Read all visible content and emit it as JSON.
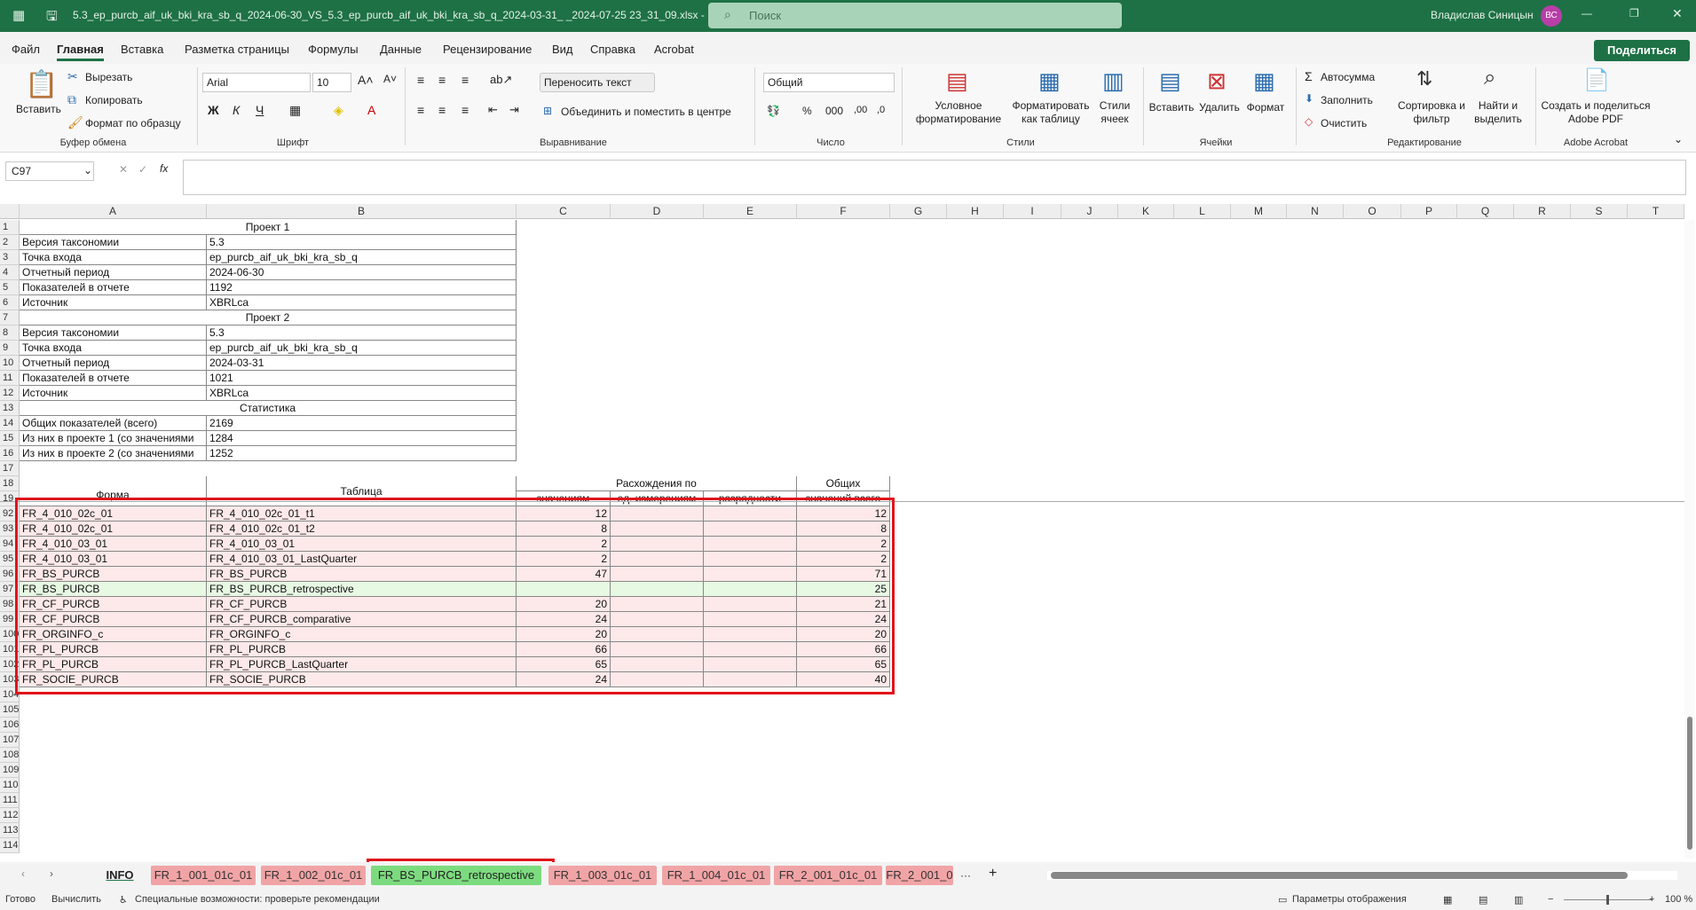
{
  "title_bar": {
    "file_name": "5.3_ep_purcb_aif_uk_bki_kra_sb_q_2024-06-30_VS_5.3_ep_purcb_aif_uk_bki_kra_sb_q_2024-03-31_ _2024-07-25 23_31_09.xlsx  -  Excel",
    "search_placeholder": "Поиск",
    "user_name": "Владислав Синицын",
    "user_initials": "ВС"
  },
  "menu": {
    "items": [
      "Файл",
      "Главная",
      "Вставка",
      "Разметка страницы",
      "Формулы",
      "Данные",
      "Рецензирование",
      "Вид",
      "Справка",
      "Acrobat"
    ],
    "active": "Главная",
    "share": "Поделиться"
  },
  "ribbon": {
    "clipboard": {
      "paste": "Вставить",
      "cut": "Вырезать",
      "copy": "Копировать",
      "format_painter": "Формат по образцу",
      "group": "Буфер обмена"
    },
    "font": {
      "name": "Arial",
      "size": "10",
      "bold": "Ж",
      "italic": "К",
      "underline": "Ч",
      "group": "Шрифт"
    },
    "alignment": {
      "wrap": "Переносить текст",
      "merge": "Объединить и поместить в центре",
      "group": "Выравнивание"
    },
    "number": {
      "format": "Общий",
      "group": "Число"
    },
    "styles": {
      "conditional": "Условное форматирование",
      "table": "Форматировать как таблицу",
      "cell_styles": "Стили ячеек",
      "group": "Стили"
    },
    "cells": {
      "insert": "Вставить",
      "delete": "Удалить",
      "format": "Формат",
      "group": "Ячейки"
    },
    "editing": {
      "autosum": "Автосумма",
      "fill": "Заполнить",
      "clear": "Очистить",
      "sort": "Сортировка и фильтр",
      "find": "Найти и выделить",
      "group": "Редактирование"
    },
    "acrobat": {
      "create": "Создать и поделиться Adobe PDF",
      "group": "Adobe Acrobat"
    }
  },
  "formula_bar": {
    "name_box": "C97",
    "fx": "fx",
    "formula": ""
  },
  "columns": [
    "A",
    "B",
    "C",
    "D",
    "E",
    "F",
    "G",
    "H",
    "I",
    "J",
    "K",
    "L",
    "M",
    "N",
    "O",
    "P",
    "Q",
    "R",
    "S",
    "T"
  ],
  "top_rows": {
    "project1_header": "Проект 1",
    "project2_header": "Проект 2",
    "stats_header": "Статистика",
    "rows": [
      {
        "n": "2",
        "label": "Версия таксономии",
        "value": "5.3"
      },
      {
        "n": "3",
        "label": "Точка входа",
        "value": "ep_purcb_aif_uk_bki_kra_sb_q"
      },
      {
        "n": "4",
        "label": "Отчетный период",
        "value": "2024-06-30"
      },
      {
        "n": "5",
        "label": "Показателей в отчете",
        "value": "1192"
      },
      {
        "n": "6",
        "label": "Источник",
        "value": "XBRLca"
      },
      {
        "n": "8",
        "label": "Версия таксономии",
        "value": "5.3"
      },
      {
        "n": "9",
        "label": "Точка входа",
        "value": "ep_purcb_aif_uk_bki_kra_sb_q"
      },
      {
        "n": "10",
        "label": "Отчетный период",
        "value": "2024-03-31"
      },
      {
        "n": "11",
        "label": "Показателей в отчете",
        "value": "1021"
      },
      {
        "n": "12",
        "label": "Источник",
        "value": "XBRLca"
      },
      {
        "n": "14",
        "label": "Общих показателей (всего)",
        "value": "2169"
      },
      {
        "n": "15",
        "label": "Из них в проекте 1 (со значениями",
        "value": "1284"
      },
      {
        "n": "16",
        "label": "Из них в проекте 2 (со значениями",
        "value": "1252"
      }
    ]
  },
  "table_header": {
    "form": "Форма",
    "table": "Таблица",
    "diff": "Расхождения по",
    "total": "Общих",
    "by_values": "значениям",
    "by_dims": "ед. измерениям",
    "by_digits": "разрядности",
    "total_values": "значений всего"
  },
  "table_rows": [
    {
      "n": "92",
      "form": "FR_4_010_02c_01",
      "table": "FR_4_010_02c_01_t1",
      "values": "12",
      "dims": "",
      "digits": "",
      "total": "12",
      "hl": "pink"
    },
    {
      "n": "93",
      "form": "FR_4_010_02c_01",
      "table": "FR_4_010_02c_01_t2",
      "values": "8",
      "dims": "",
      "digits": "",
      "total": "8",
      "hl": "pink"
    },
    {
      "n": "94",
      "form": "FR_4_010_03_01",
      "table": "FR_4_010_03_01",
      "values": "2",
      "dims": "",
      "digits": "",
      "total": "2",
      "hl": "pink"
    },
    {
      "n": "95",
      "form": "FR_4_010_03_01",
      "table": "FR_4_010_03_01_LastQuarter",
      "values": "2",
      "dims": "",
      "digits": "",
      "total": "2",
      "hl": "pink"
    },
    {
      "n": "96",
      "form": "FR_BS_PURCB",
      "table": "FR_BS_PURCB",
      "values": "47",
      "dims": "",
      "digits": "",
      "total": "71",
      "hl": "pink"
    },
    {
      "n": "97",
      "form": "FR_BS_PURCB",
      "table": "FR_BS_PURCB_retrospective",
      "values": "",
      "dims": "",
      "digits": "",
      "total": "25",
      "hl": "green"
    },
    {
      "n": "98",
      "form": "FR_CF_PURCB",
      "table": "FR_CF_PURCB",
      "values": "20",
      "dims": "",
      "digits": "",
      "total": "21",
      "hl": "pink"
    },
    {
      "n": "99",
      "form": "FR_CF_PURCB",
      "table": "FR_CF_PURCB_comparative",
      "values": "24",
      "dims": "",
      "digits": "",
      "total": "24",
      "hl": "pink"
    },
    {
      "n": "100",
      "form": "FR_ORGINFO_c",
      "table": "FR_ORGINFO_c",
      "values": "20",
      "dims": "",
      "digits": "",
      "total": "20",
      "hl": "pink"
    },
    {
      "n": "101",
      "form": "FR_PL_PURCB",
      "table": "FR_PL_PURCB",
      "values": "66",
      "dims": "",
      "digits": "",
      "total": "66",
      "hl": "pink"
    },
    {
      "n": "102",
      "form": "FR_PL_PURCB",
      "table": "FR_PL_PURCB_LastQuarter",
      "values": "65",
      "dims": "",
      "digits": "",
      "total": "65",
      "hl": "pink"
    },
    {
      "n": "103",
      "form": "FR_SOCIE_PURCB",
      "table": "FR_SOCIE_PURCB",
      "values": "24",
      "dims": "",
      "digits": "",
      "total": "40",
      "hl": "pink"
    }
  ],
  "row_numbers": [
    "1",
    "2",
    "3",
    "4",
    "5",
    "6",
    "7",
    "8",
    "9",
    "10",
    "11",
    "12",
    "13",
    "14",
    "15",
    "16",
    "17",
    "18",
    "19",
    "92",
    "93",
    "94",
    "95",
    "96",
    "97",
    "98",
    "99",
    "100",
    "101",
    "102",
    "103",
    "104",
    "105",
    "106",
    "107",
    "108",
    "109",
    "110",
    "111",
    "112",
    "113",
    "114"
  ],
  "sheet_tabs": [
    {
      "label": "INFO",
      "kind": "plain"
    },
    {
      "label": "FR_1_001_01c_01",
      "kind": "red"
    },
    {
      "label": "FR_1_002_01c_01",
      "kind": "red"
    },
    {
      "label": "FR_BS_PURCB_retrospective",
      "kind": "grn"
    },
    {
      "label": "FR_1_003_01c_01",
      "kind": "red"
    },
    {
      "label": "FR_1_004_01c_01",
      "kind": "red"
    },
    {
      "label": "FR_2_001_01c_01",
      "kind": "red"
    },
    {
      "label": "FR_2_001_0",
      "kind": "red"
    }
  ],
  "status_bar": {
    "ready": "Готово",
    "calculate": "Вычислить",
    "accessibility": "Специальные возможности: проверьте рекомендации",
    "display_settings": "Параметры отображения",
    "zoom": "100 %"
  }
}
